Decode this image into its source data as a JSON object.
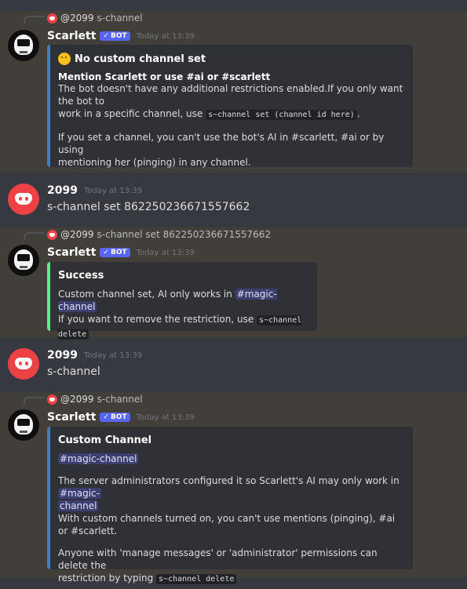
{
  "messages": [
    {
      "reply": {
        "author": "@2099",
        "text": "s-channel"
      },
      "author": "Scarlett",
      "bot_tag": "BOT",
      "timestamp": "Today at 13:39",
      "embed": {
        "title": "No custom channel set",
        "subtitle": "Mention Scarlett or use #ai or #scarlett",
        "p1_a": "The bot doesn't have any additional restrictions enabled.If you only want the bot to",
        "p1_b": "work in a specific channel, use",
        "p1_code": "s~channel set (channel id here)",
        "p1_c": ".",
        "p2_a": "If you set a channel, you can't use the bot's AI in #scarlett, #ai or by using",
        "p2_b": "mentioning her (pinging) in any channel."
      }
    },
    {
      "author": "2099",
      "timestamp": "Today at 13:39",
      "content": "s-channel set 862250236671557662"
    },
    {
      "reply": {
        "author": "@2099",
        "text": "s-channel set 862250236671557662"
      },
      "author": "Scarlett",
      "bot_tag": "BOT",
      "timestamp": "Today at 13:39",
      "embed": {
        "title": "Success",
        "l1_a": "Custom channel set, AI only works in",
        "l1_mention": "#magic-channel",
        "l2_a": "If you want to remove the restriction, use",
        "l2_code": "s~channel delete"
      }
    },
    {
      "author": "2099",
      "timestamp": "Today at 13:39",
      "content": "s-channel"
    },
    {
      "reply": {
        "author": "@2099",
        "text": "s-channel"
      },
      "author": "Scarlett",
      "bot_tag": "BOT",
      "timestamp": "Today at 13:39",
      "embed": {
        "title": "Custom Channel",
        "mention_top": "#magic-channel",
        "p1_a": "The server administrators configured it so Scarlett's AI may only work in",
        "p1_mention_a": "#magic-",
        "p1_mention_b": "channel",
        "p1_b": "With custom channels turned on, you can't use mentions (pinging), #ai or #scarlett.",
        "p2_a": "Anyone with 'manage messages' or 'administrator' permissions can delete the",
        "p2_b": "restriction by typing",
        "p2_code": "s~channel delete"
      }
    }
  ]
}
